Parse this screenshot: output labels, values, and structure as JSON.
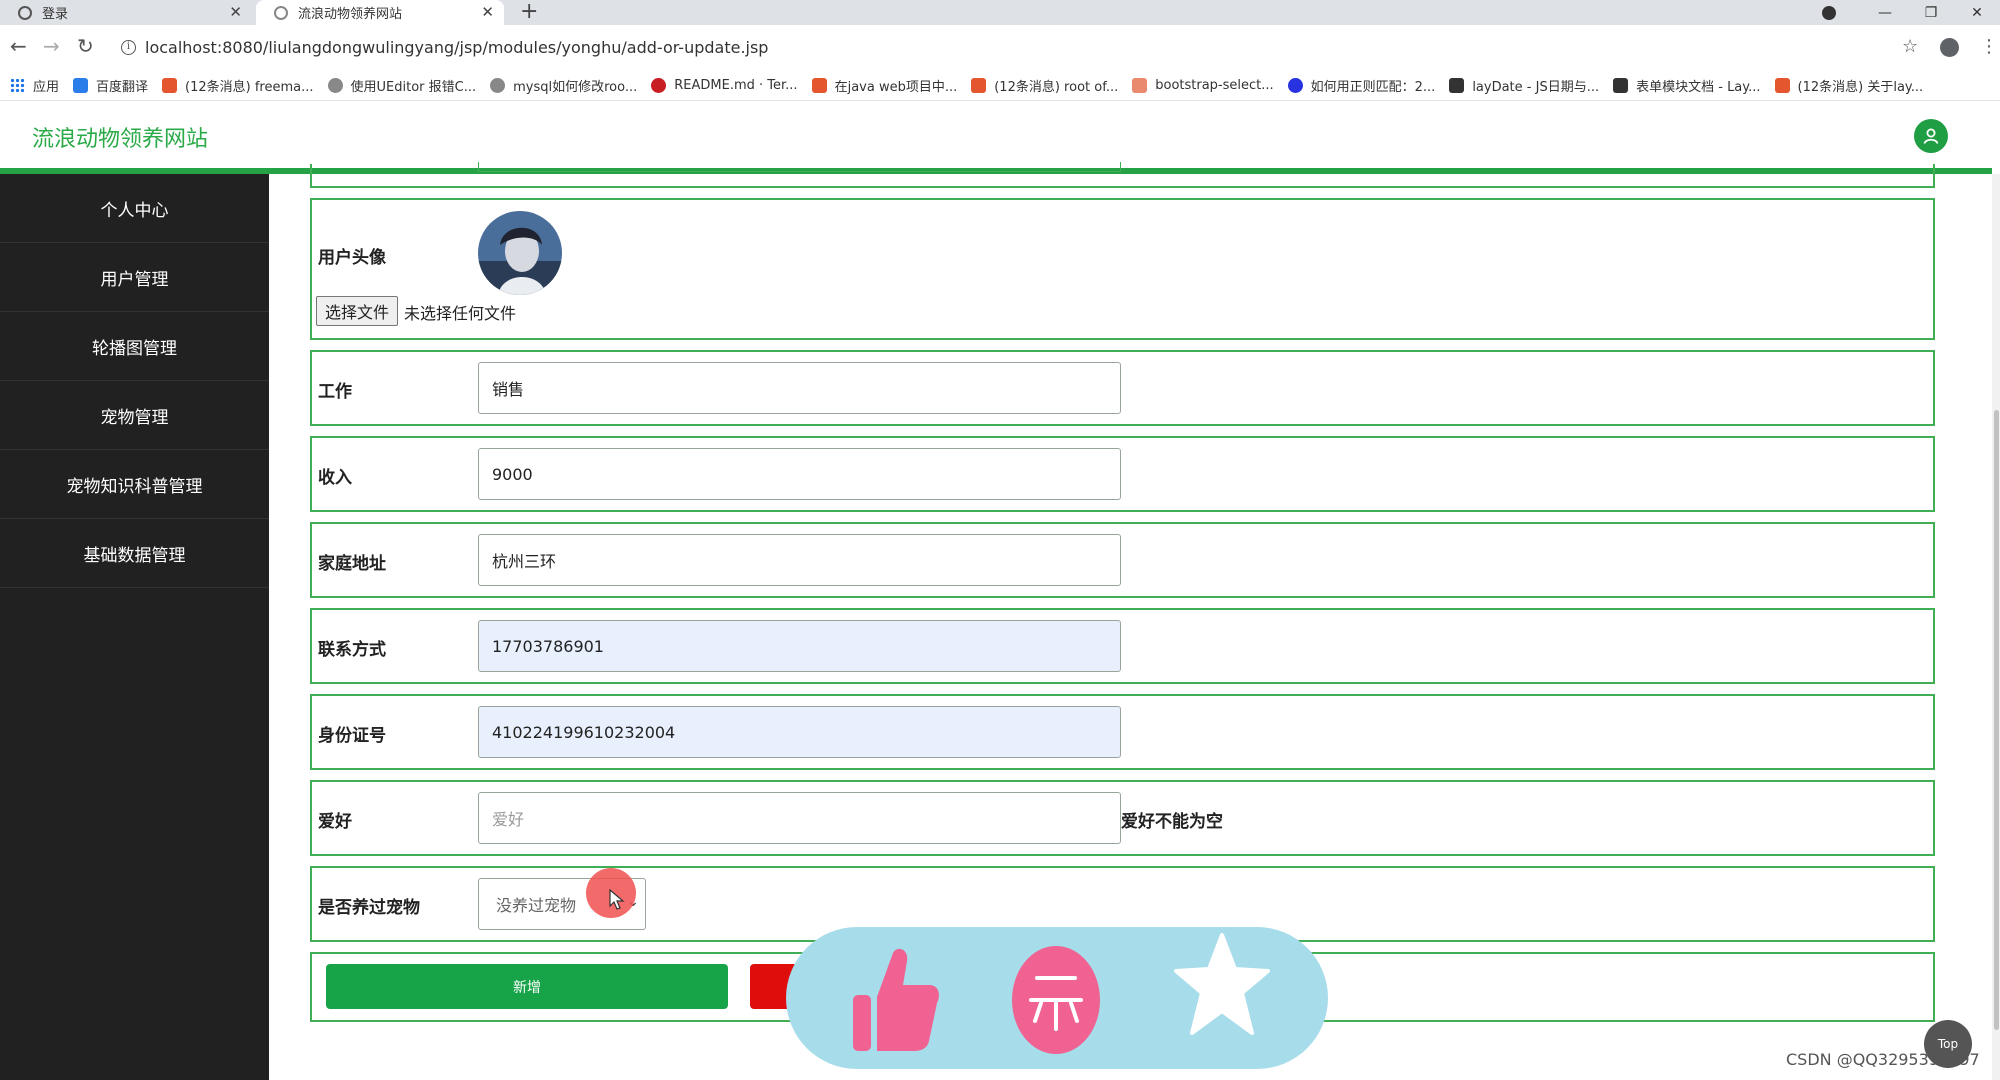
{
  "browser": {
    "tabs": [
      {
        "title": "登录"
      },
      {
        "title": "流浪动物领养网站",
        "active": true
      }
    ],
    "url": "localhost:8080/liulangdongwulingyang/jsp/modules/yonghu/add-or-update.jsp",
    "bookmarks": [
      {
        "label": "应用",
        "icon": "apps-grid-icon"
      },
      {
        "label": "百度翻译",
        "icon": "translate-icon",
        "color": "#2b7de9"
      },
      {
        "label": "(12条消息) freema...",
        "icon": "csdn-icon",
        "color": "#e4572e"
      },
      {
        "label": "使用UEditor 报错C...",
        "icon": "link-icon",
        "color": "#666666"
      },
      {
        "label": "mysql如何修改roo...",
        "icon": "link-icon",
        "color": "#666666"
      },
      {
        "label": "README.md · Ter...",
        "icon": "gitee-icon",
        "color": "#c71d23"
      },
      {
        "label": "在java web项目中...",
        "icon": "csdn-icon",
        "color": "#e4572e"
      },
      {
        "label": "(12条消息) root of...",
        "icon": "csdn-icon",
        "color": "#e4572e"
      },
      {
        "label": "bootstrap-select...",
        "icon": "doc-icon",
        "color": "#e4572e"
      },
      {
        "label": "如何用正则匹配：2...",
        "icon": "baidu-paw-icon",
        "color": "#2932e1"
      },
      {
        "label": "layDate - JS日期与...",
        "icon": "layui-icon",
        "color": "#333333"
      },
      {
        "label": "表单模块文档 - Lay...",
        "icon": "layui-icon",
        "color": "#333333"
      },
      {
        "label": "(12条消息) 关于lay...",
        "icon": "csdn-icon",
        "color": "#e4572e"
      }
    ]
  },
  "header": {
    "site_title": "流浪动物领养网站",
    "user_icon": "user-icon"
  },
  "sidebar": {
    "items": [
      {
        "label": "个人中心"
      },
      {
        "label": "用户管理"
      },
      {
        "label": "轮播图管理"
      },
      {
        "label": "宠物管理"
      },
      {
        "label": "宠物知识科普管理"
      },
      {
        "label": "基础数据管理"
      }
    ]
  },
  "form": {
    "avatar": {
      "label": "用户头像",
      "file_button": "选择文件",
      "file_status": "未选择任何文件"
    },
    "job": {
      "label": "工作",
      "value": "销售"
    },
    "income": {
      "label": "收入",
      "value": "9000"
    },
    "address": {
      "label": "家庭地址",
      "value": "杭州三环"
    },
    "phone": {
      "label": "联系方式",
      "value": "17703786901"
    },
    "id_number": {
      "label": "身份证号",
      "value": "410224199610232004"
    },
    "hobby": {
      "label": "爱好",
      "placeholder": "爱好",
      "error": "爱好不能为空"
    },
    "pet_history": {
      "label": "是否养过宠物",
      "selected": "没养过宠物"
    },
    "buttons": {
      "add": "新增"
    }
  },
  "widgets": {
    "top_button": "Top",
    "watermark": "CSDN @QQ3295391197"
  },
  "colors": {
    "brand_green": "#24a245",
    "sidebar_bg": "#212121",
    "cancel_red": "#e00d0d",
    "like_pink": "#f06292",
    "pill_blue": "#a7dcea"
  }
}
